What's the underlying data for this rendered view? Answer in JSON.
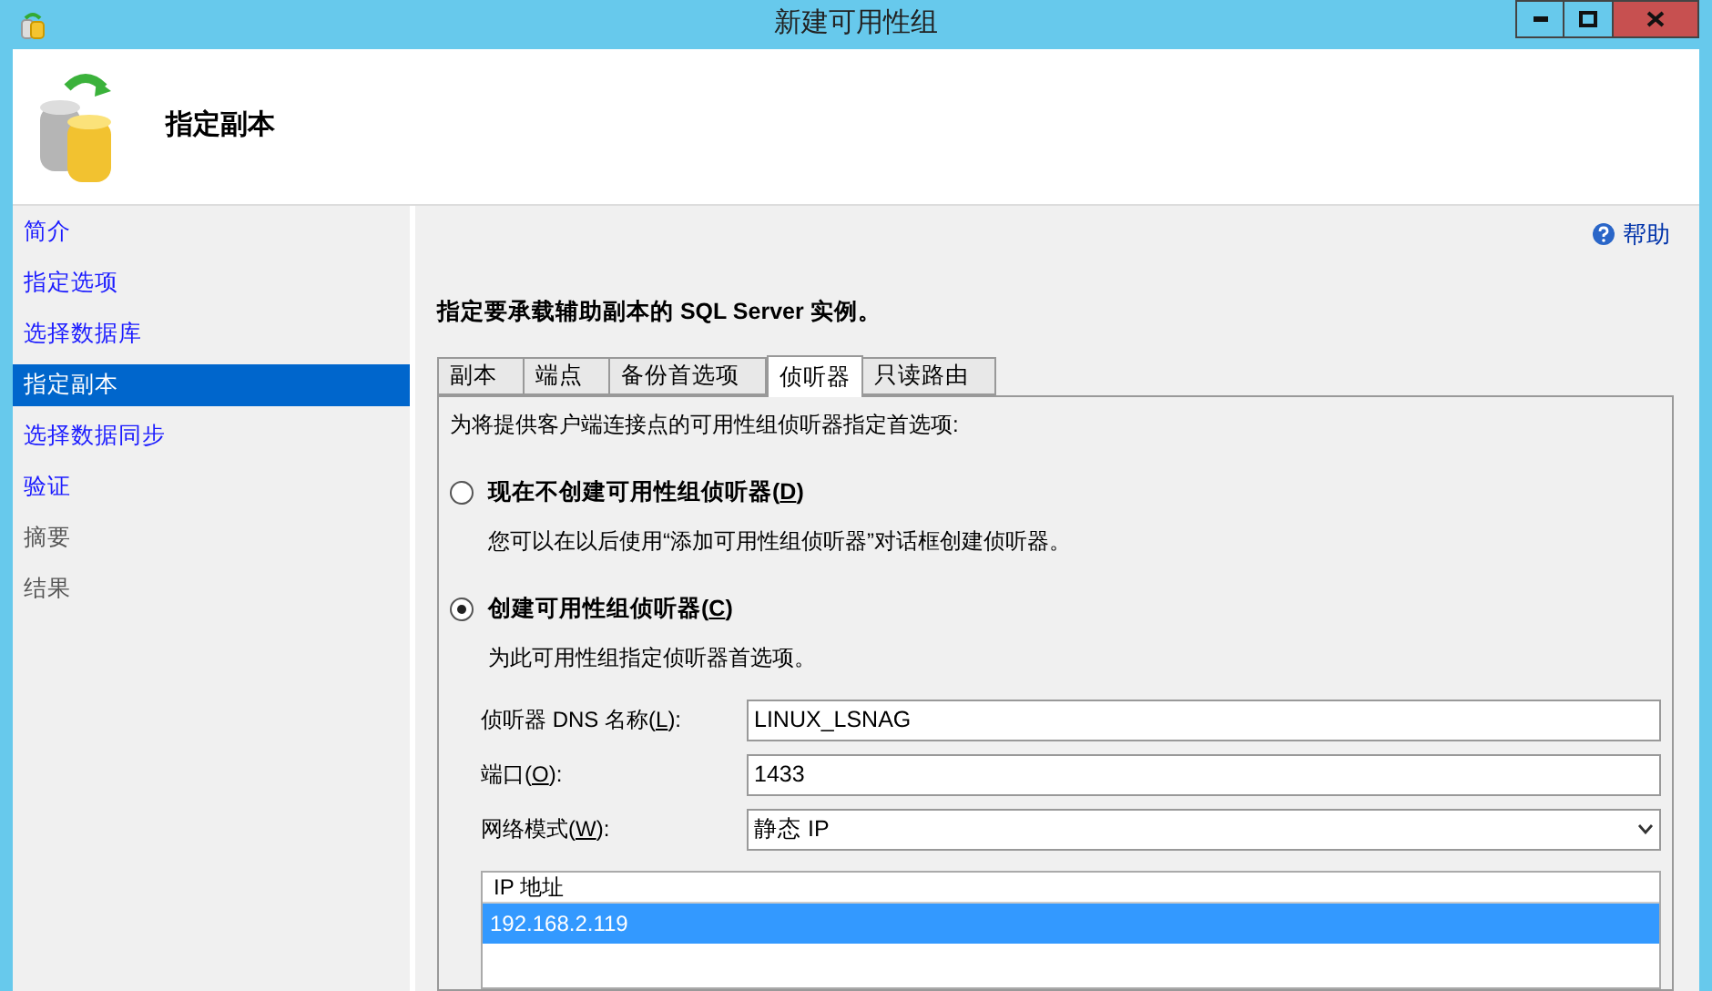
{
  "window": {
    "title": "新建可用性组"
  },
  "header": {
    "title": "指定副本"
  },
  "sidebar": {
    "items": [
      {
        "label": "简介",
        "selected": false,
        "disabled": false
      },
      {
        "label": "指定选项",
        "selected": false,
        "disabled": false
      },
      {
        "label": "选择数据库",
        "selected": false,
        "disabled": false
      },
      {
        "label": "指定副本",
        "selected": true,
        "disabled": false
      },
      {
        "label": "选择数据同步",
        "selected": false,
        "disabled": false
      },
      {
        "label": "验证",
        "selected": false,
        "disabled": false
      },
      {
        "label": "摘要",
        "selected": false,
        "disabled": true
      },
      {
        "label": "结果",
        "selected": false,
        "disabled": true
      }
    ]
  },
  "help": {
    "label": "帮助"
  },
  "instruction": "指定要承载辅助副本的 SQL Server 实例。",
  "tabs": [
    {
      "label": "副本",
      "selected": false
    },
    {
      "label": "端点",
      "selected": false
    },
    {
      "label": "备份首选项",
      "selected": false
    },
    {
      "label": "侦听器",
      "selected": true
    },
    {
      "label": "只读路由",
      "selected": false
    }
  ],
  "panel": {
    "intro": "为将提供客户端连接点的可用性组侦听器指定首选项:",
    "options": [
      {
        "label_start": "现在不创建可用性组侦听器(",
        "mnemonic": "D",
        "label_end": ")",
        "selected": false,
        "description": "您可以在以后使用“添加可用性组侦听器”对话框创建侦听器。"
      },
      {
        "label_start": "创建可用性组侦听器(",
        "mnemonic": "C",
        "label_end": ")",
        "selected": true,
        "description": "为此可用性组指定侦听器首选项。"
      }
    ],
    "fields": [
      {
        "kind": "text",
        "label_start": "侦听器 DNS 名称(",
        "mnemonic": "L",
        "label_end": "):",
        "value": "LINUX_LSNAG"
      },
      {
        "kind": "text",
        "label_start": "端口(",
        "mnemonic": "O",
        "label_end": "):",
        "value": "1433"
      },
      {
        "kind": "dropdown",
        "label_start": "网络模式(",
        "mnemonic": "W",
        "label_end": "):",
        "value": "静态 IP"
      }
    ],
    "ip_table": {
      "columns": [
        "IP 地址"
      ],
      "rows": [
        {
          "cells": [
            "192.168.2.119"
          ],
          "selected": true
        }
      ]
    }
  }
}
